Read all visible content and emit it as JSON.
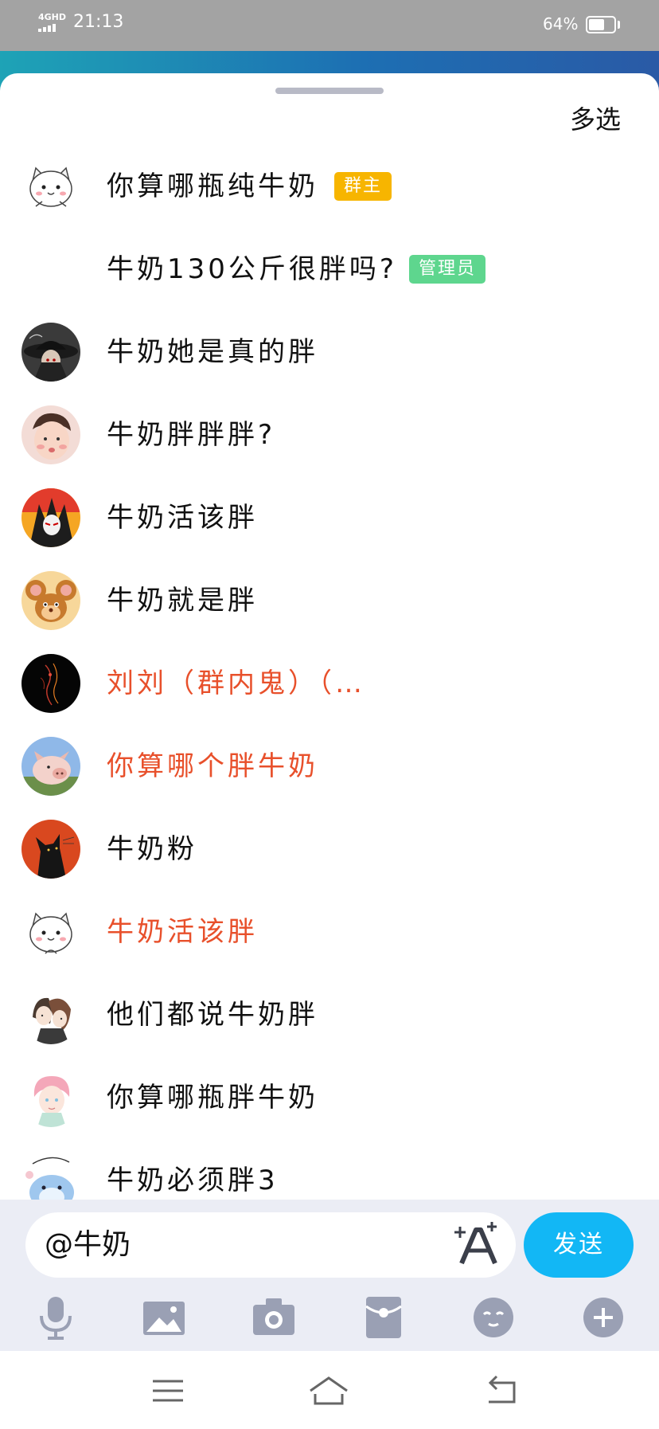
{
  "status_bar": {
    "network": "4GHD",
    "time": "21:13",
    "battery_percent": "64%",
    "battery_level": 0.64
  },
  "header": {
    "multi_select_label": "多选"
  },
  "members": [
    {
      "name": "你算哪瓶纯牛奶",
      "badge": "群主",
      "badge_type": "owner",
      "name_color": "#111111",
      "avatar": "cat-avatar"
    },
    {
      "name": "牛奶130公斤很胖吗?",
      "badge": "管理员",
      "badge_type": "admin",
      "name_color": "#111111",
      "avatar": "none"
    },
    {
      "name": "牛奶她是真的胖",
      "name_color": "#111111",
      "avatar": "dark-character-avatar"
    },
    {
      "name": "牛奶胖胖胖?",
      "name_color": "#111111",
      "avatar": "baby-photo-avatar"
    },
    {
      "name": "牛奶活该胖",
      "name_color": "#111111",
      "avatar": "anime-character-avatar"
    },
    {
      "name": "牛奶就是胖",
      "name_color": "#111111",
      "avatar": "cartoon-mouse-avatar"
    },
    {
      "name": "刘刘（群内鬼）（…",
      "name_color": "#e8502b",
      "avatar": "dark-art-avatar"
    },
    {
      "name": "你算哪个胖牛奶",
      "name_color": "#e8502b",
      "avatar": "pig-photo-avatar"
    },
    {
      "name": "牛奶粉",
      "name_color": "#111111",
      "avatar": "black-cat-avatar"
    },
    {
      "name": "牛奶活该胖",
      "name_color": "#e8502b",
      "avatar": "cat-avatar"
    },
    {
      "name": "他们都说牛奶胖",
      "name_color": "#111111",
      "avatar": "couple-illustration-avatar"
    },
    {
      "name": "你算哪瓶胖牛奶",
      "name_color": "#111111",
      "avatar": "boy-illustration-avatar"
    },
    {
      "name": "牛奶必须胖3",
      "name_color": "#111111",
      "avatar": "blue-creature-avatar"
    }
  ],
  "input": {
    "value": "@牛奶",
    "send_label": "发送"
  },
  "toolbar": {
    "icons": [
      "microphone-icon",
      "image-icon",
      "camera-icon",
      "red-packet-icon",
      "emoji-icon",
      "plus-icon"
    ]
  },
  "colors": {
    "send": "#12b7f5",
    "owner_badge": "#f7b500",
    "admin_badge": "#5ed68e",
    "highlight_name": "#e8502b",
    "input_area": "#ebedf5"
  }
}
